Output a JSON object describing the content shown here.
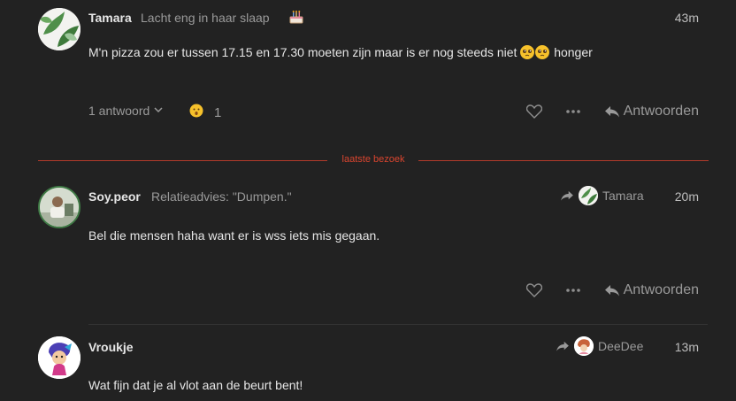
{
  "posts": [
    {
      "username": "Tamara",
      "user_title": "Lacht eng in haar slaap",
      "title_badge_icon": "birthday-cake-icon",
      "time": "43m",
      "body_text": "M'n pizza zou er tussen 17.15 en 17.30 moeten zijn maar is er nog steeds niet",
      "body_emoji": "pleading-face-icon",
      "body_suffix": "honger",
      "replies_label": "1 antwoord",
      "reaction_icon": "astonished-face-icon",
      "reaction_count": "1",
      "reply_label": "Antwoorden",
      "avatar_icon": "leaf-pattern-avatar"
    },
    {
      "username": "Soy.peor",
      "user_title": "Relatieadvies: \"Dumpen.\"",
      "time": "20m",
      "reply_to_user": "Tamara",
      "body_text": "Bel die mensen haha want er is wss iets mis gegaan.",
      "reply_label": "Antwoorden",
      "avatar_icon": "photo-avatar"
    },
    {
      "username": "Vroukje",
      "time": "13m",
      "reply_to_user": "DeeDee",
      "body_text": "Wat fijn dat je al vlot aan de beurt bent!",
      "avatar_icon": "cartoon-avatar"
    }
  ],
  "divider": {
    "label": "laatste bezoek",
    "color": "#d9452f"
  },
  "colors": {
    "background": "#222222",
    "text": "#e6e6e6",
    "muted": "#9a9a9a"
  }
}
